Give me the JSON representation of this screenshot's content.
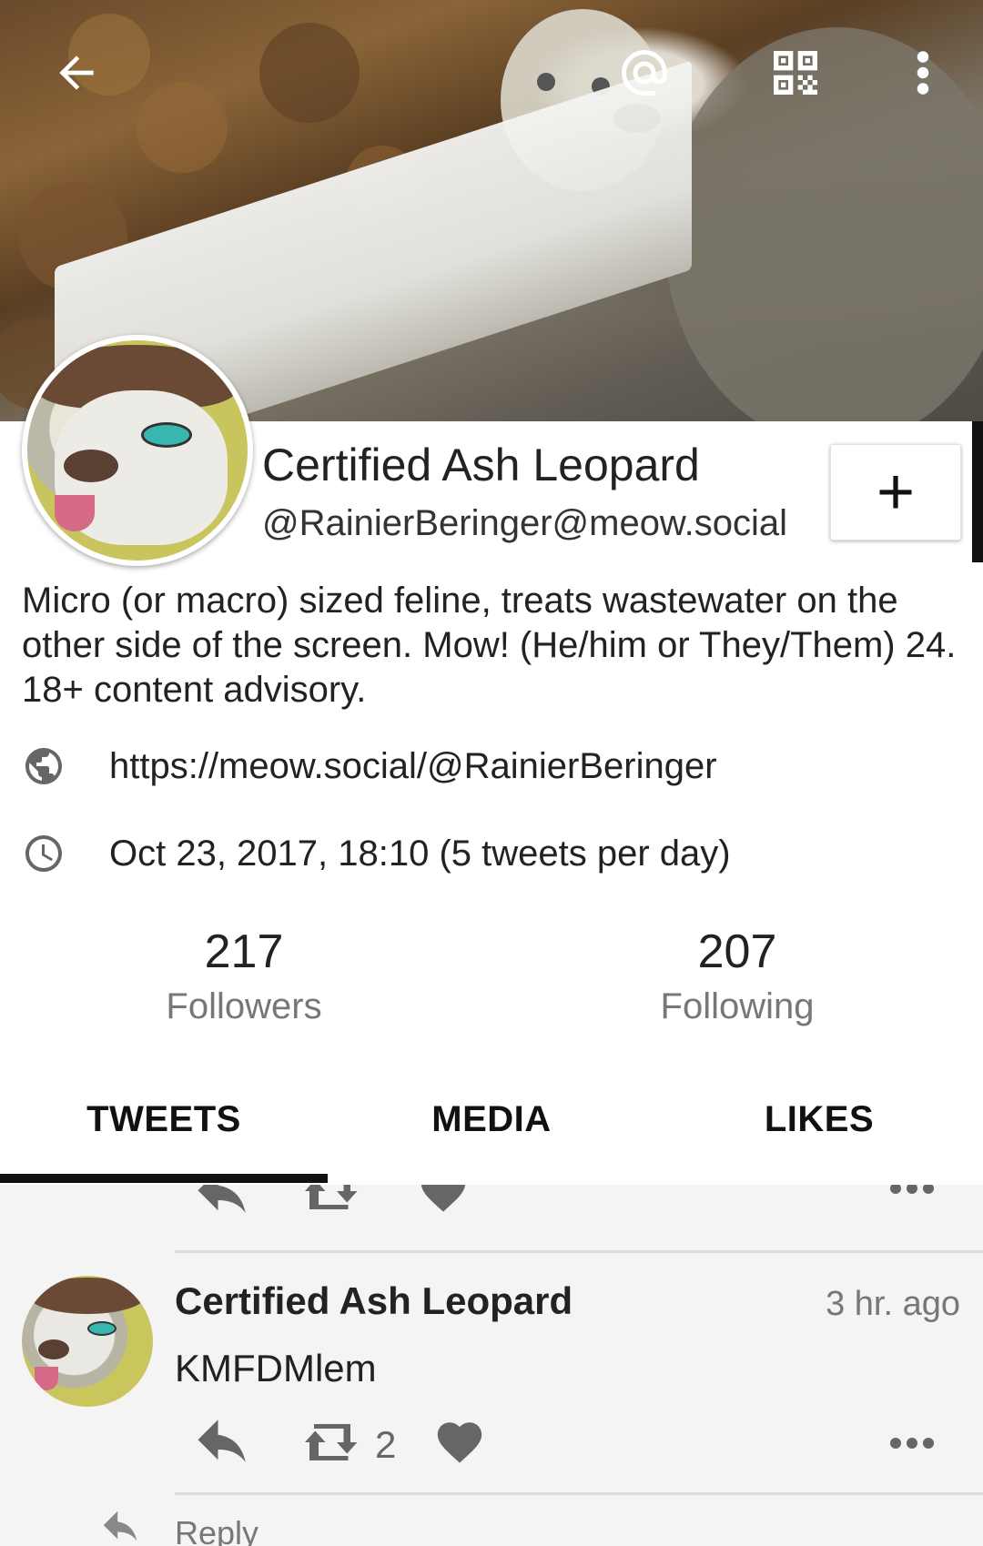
{
  "header": {
    "back_icon": "arrow-left-icon",
    "mention_icon": "at-sign-icon",
    "qr_icon": "qr-code-icon",
    "menu_icon": "more-vertical-icon",
    "banner_description": "snow leopard in a cardboard box"
  },
  "profile": {
    "display_name": "Certified Ash Leopard",
    "handle": "@RainierBeringer@meow.social",
    "follow_button_label": "+",
    "bio": "Micro (or macro) sized feline, treats wastewater on the other side of the screen. Mow! (He/him or They/Them) 24. 18+ content advisory.",
    "website": "https://meow.social/@RainierBeringer",
    "joined": "Oct 23, 2017, 18:10 (5 tweets per day)",
    "stats": {
      "followers_count": "217",
      "followers_label": "Followers",
      "following_count": "207",
      "following_label": "Following"
    }
  },
  "tabs": [
    {
      "label": "TWEETS",
      "active": true
    },
    {
      "label": "MEDIA",
      "active": false
    },
    {
      "label": "LIKES",
      "active": false
    }
  ],
  "feed": {
    "post": {
      "author": "Certified Ash Leopard",
      "time": "3 hr. ago",
      "text": "KMFDMlem",
      "retweet_count": "2"
    },
    "reply_label": "Reply"
  },
  "colors": {
    "text": "#222222",
    "muted": "#777777",
    "icon_gray": "#666666",
    "tab_indicator": "#111111",
    "background": "#f4f4f4"
  }
}
